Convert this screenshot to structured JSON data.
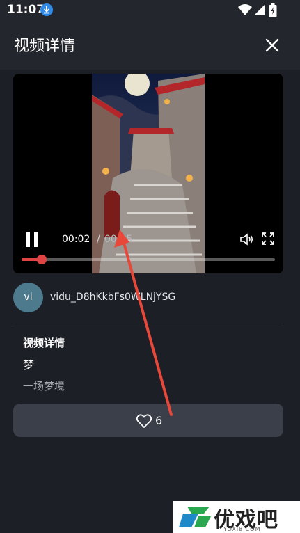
{
  "status_bar": {
    "time": "11:07"
  },
  "header": {
    "title": "视频详情"
  },
  "player": {
    "current_time": "00:02",
    "separator": "/",
    "total_time": "00:25",
    "progress_fraction": 0.08
  },
  "author": {
    "avatar_initials": "vi",
    "name": "vidu_D8hKkbFs0WLNjYSG"
  },
  "details": {
    "heading": "视频详情",
    "title": "梦",
    "description": "一场梦境"
  },
  "like": {
    "count": "6"
  },
  "watermark": {
    "text": "优戏吧",
    "url": "YOXI8.COM"
  },
  "colors": {
    "background": "#1c1f26",
    "header": "#23262d",
    "progress": "#e04343",
    "like_button": "#3a3f4a",
    "arrow": "#e8483a"
  }
}
